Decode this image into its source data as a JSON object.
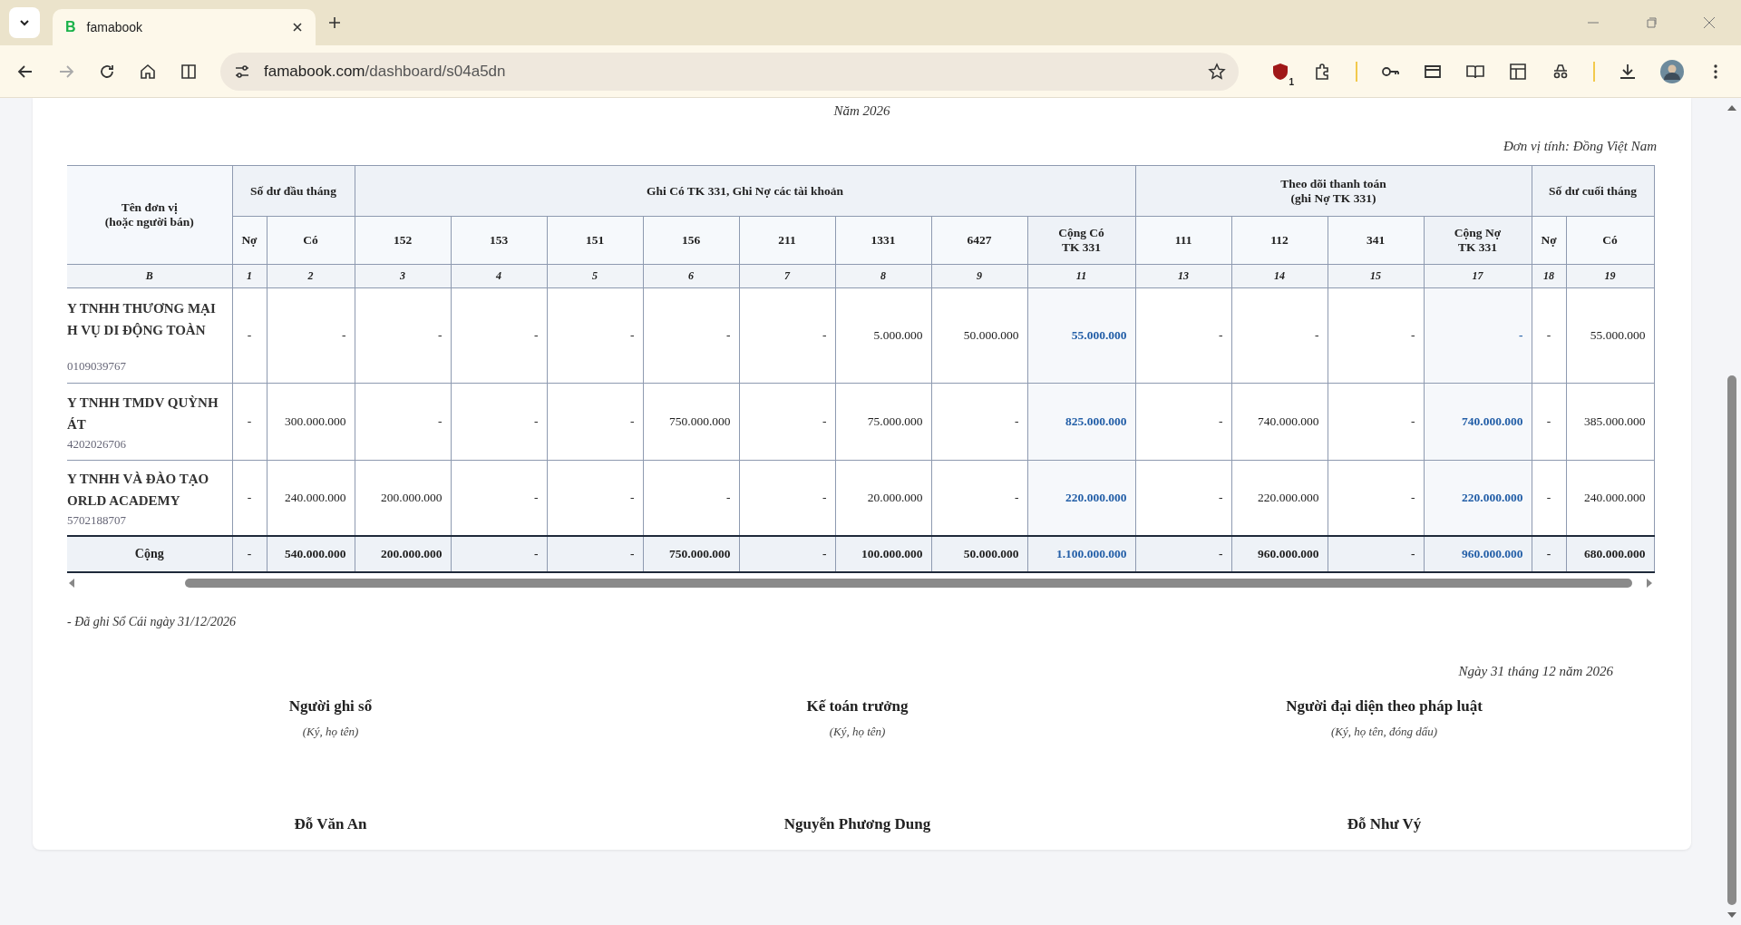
{
  "browser": {
    "tab": {
      "favicon_letter": "B",
      "title": "famabook",
      "selected": true
    },
    "address": {
      "host": "famabook.com",
      "path": "/dashboard/s04a5dn"
    },
    "extension_badge": "1"
  },
  "report": {
    "year": "Năm 2026",
    "unit": "Đơn vị tính: Đồng Việt Nam"
  },
  "table": {
    "name_header": "Tên đơn vị\n(hoặc người bán)",
    "name_index": "B",
    "groups": [
      {
        "label": "Số dư đầu tháng",
        "columns": [
          {
            "label": "Nợ",
            "index": "1",
            "kind": "narrow"
          },
          {
            "label": "Có",
            "index": "2",
            "kind": "balance"
          }
        ]
      },
      {
        "label": "Ghi Có TK 331, Ghi Nợ các tài khoản",
        "columns": [
          {
            "label": "152",
            "index": "3",
            "kind": "amount"
          },
          {
            "label": "153",
            "index": "4",
            "kind": "amount"
          },
          {
            "label": "151",
            "index": "5",
            "kind": "amount"
          },
          {
            "label": "156",
            "index": "6",
            "kind": "amount"
          },
          {
            "label": "211",
            "index": "7",
            "kind": "amount"
          },
          {
            "label": "1331",
            "index": "8",
            "kind": "amount"
          },
          {
            "label": "6427",
            "index": "9",
            "kind": "amount"
          },
          {
            "label": "Cộng Có\nTK 331",
            "index": "11",
            "kind": "sum"
          }
        ]
      },
      {
        "label": "Theo dõi thanh toán\n(ghi Nợ TK 331)",
        "columns": [
          {
            "label": "111",
            "index": "13",
            "kind": "amount"
          },
          {
            "label": "112",
            "index": "14",
            "kind": "amount"
          },
          {
            "label": "341",
            "index": "15",
            "kind": "amount"
          },
          {
            "label": "Cộng Nợ\nTK 331",
            "index": "17",
            "kind": "sum"
          }
        ]
      },
      {
        "label": "Số dư cuối tháng",
        "columns": [
          {
            "label": "Nợ",
            "index": "18",
            "kind": "narrow"
          },
          {
            "label": "Có",
            "index": "19",
            "kind": "balance"
          }
        ]
      }
    ],
    "rows": [
      {
        "name_lines": [
          "Y TNHH THƯƠNG MẠI",
          "H VỤ DI ĐỘNG TOÀN"
        ],
        "tax_code": "0109039767",
        "values": [
          "-",
          "-",
          "-",
          "-",
          "-",
          "-",
          "-",
          "5.000.000",
          "50.000.000",
          "55.000.000",
          "-",
          "-",
          "-",
          "-",
          "-",
          "55.000.000"
        ]
      },
      {
        "name_lines": [
          "Y TNHH TMDV QUỲNH",
          "ÁT"
        ],
        "tax_code": "4202026706",
        "values": [
          "-",
          "300.000.000",
          "-",
          "-",
          "-",
          "750.000.000",
          "-",
          "75.000.000",
          "-",
          "825.000.000",
          "-",
          "740.000.000",
          "-",
          "740.000.000",
          "-",
          "385.000.000"
        ]
      },
      {
        "name_lines": [
          "Y TNHH VÀ ĐÀO TẠO",
          "ORLD ACADEMY"
        ],
        "tax_code": "5702188707",
        "values": [
          "-",
          "240.000.000",
          "200.000.000",
          "-",
          "-",
          "-",
          "-",
          "20.000.000",
          "-",
          "220.000.000",
          "-",
          "220.000.000",
          "-",
          "220.000.000",
          "-",
          "240.000.000"
        ]
      }
    ],
    "total": {
      "label": "Cộng",
      "values": [
        "-",
        "540.000.000",
        "200.000.000",
        "-",
        "-",
        "750.000.000",
        "-",
        "100.000.000",
        "50.000.000",
        "1.100.000.000",
        "-",
        "960.000.000",
        "-",
        "960.000.000",
        "-",
        "680.000.000"
      ]
    }
  },
  "footnote": "- Đã ghi Sổ Cái ngày 31/12/2026",
  "date_line": "Ngày 31 tháng 12 năm 2026",
  "signatures": [
    {
      "title": "Người ghi sổ",
      "hint": "(Ký, họ tên)",
      "name": "Đỗ Văn An"
    },
    {
      "title": "Kế toán trưởng",
      "hint": "(Ký, họ tên)",
      "name": "Nguyễn Phương Dung"
    },
    {
      "title": "Người đại diện theo pháp luật",
      "hint": "(Ký, họ tên, đóng dấu)",
      "name": "Đỗ Như Vý"
    }
  ]
}
